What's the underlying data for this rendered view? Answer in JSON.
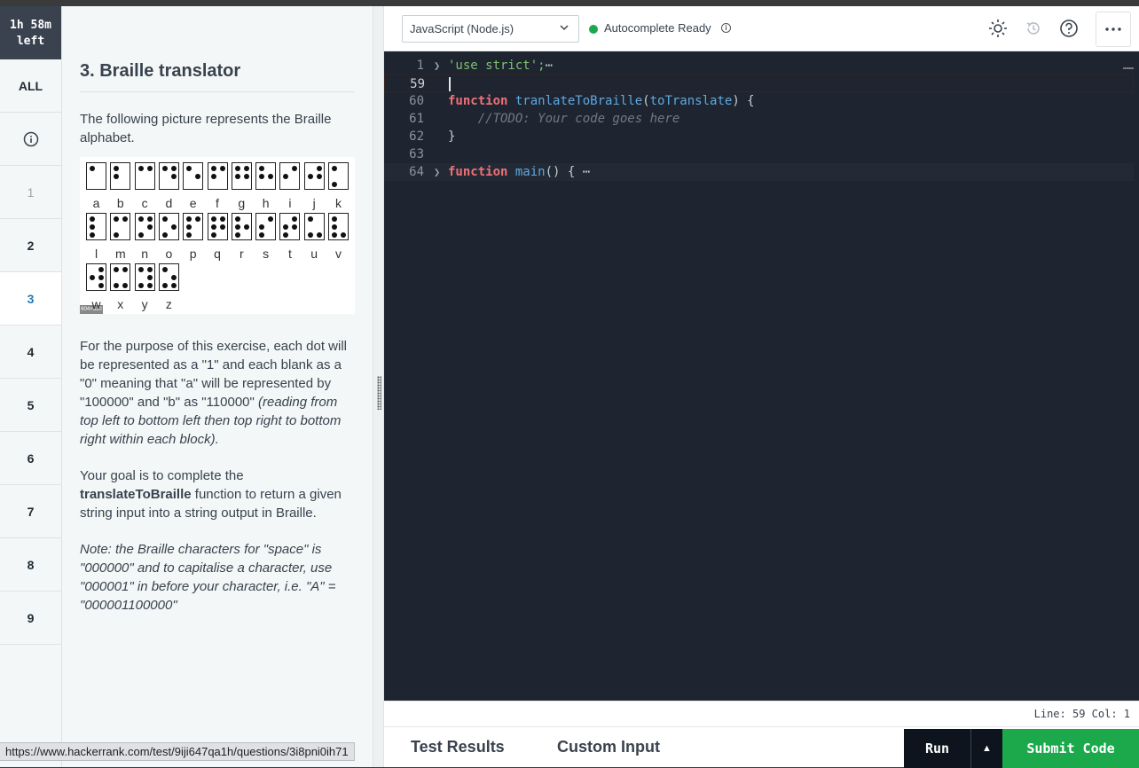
{
  "timer": {
    "line1": "1h 58m",
    "line2": "left"
  },
  "nav": {
    "all_label": "ALL",
    "info_icon": "info-icon",
    "questions": [
      "1",
      "2",
      "3",
      "4",
      "5",
      "6",
      "7",
      "8",
      "9"
    ],
    "active": "3"
  },
  "question": {
    "title": "3. Braille translator",
    "intro": "The following picture represents the Braille alphabet.",
    "braille_letters": [
      "a",
      "b",
      "c",
      "d",
      "e",
      "f",
      "g",
      "h",
      "i",
      "j",
      "k",
      "l",
      "m",
      "n",
      "o",
      "p",
      "q",
      "r",
      "s",
      "t",
      "u",
      "v",
      "w",
      "x",
      "y",
      "z"
    ],
    "image_size_label": "604×330",
    "para2_plain": "For the purpose of this exercise, each dot will be represented as a \"1\" and each blank as a \"0\" meaning that \"a\" will be represented by \"100000\" and \"b\" as \"110000\" ",
    "para2_italic": "(reading from top left to bottom left then top right to bottom right within each block).",
    "para3_pre": "Your goal is to complete the ",
    "para3_bold": "translateToBraille",
    "para3_post": " function to return a given string input into a string output in Braille.",
    "note": "Note: the Braille characters for \"space\" is \"000000\" and to capitalise a character, use \"000001\" in before your character, i.e. \"A\" = \"000001100000\""
  },
  "toolbar": {
    "language": "JavaScript (Node.js)",
    "autocomplete": "Autocomplete Ready",
    "autocomplete_info": "i",
    "theme_icon": "sun-icon",
    "history_icon": "history-icon",
    "help_icon": "help-icon",
    "more_icon": "more-icon"
  },
  "editor": {
    "lines": [
      {
        "num": "1",
        "folded": true,
        "text_str": "'use strict';",
        "ellipsis": "⋯"
      },
      {
        "num": "59",
        "cursor": true
      },
      {
        "num": "60",
        "kw": "function",
        "fn": " tranlateToBraille",
        "p1": "(",
        "arg": "toTranslate",
        "p2": ") {"
      },
      {
        "num": "61",
        "comment": "    //TODO: Your code goes here"
      },
      {
        "num": "62",
        "plain": "}"
      },
      {
        "num": "63"
      },
      {
        "num": "64",
        "folded": true,
        "kw": "function",
        "fn": " main",
        "p2": "() {",
        "ellipsis": "⋯"
      }
    ]
  },
  "status": {
    "position": "Line: 59 Col: 1"
  },
  "bottom": {
    "tab_results": "Test Results",
    "tab_custom": "Custom Input",
    "run": "Run",
    "run_menu_icon": "caret-up-icon",
    "submit": "Submit Code"
  },
  "url": "https://www.hackerrank.com/test/9iji647qa1h/questions/3i8pni0ih71"
}
